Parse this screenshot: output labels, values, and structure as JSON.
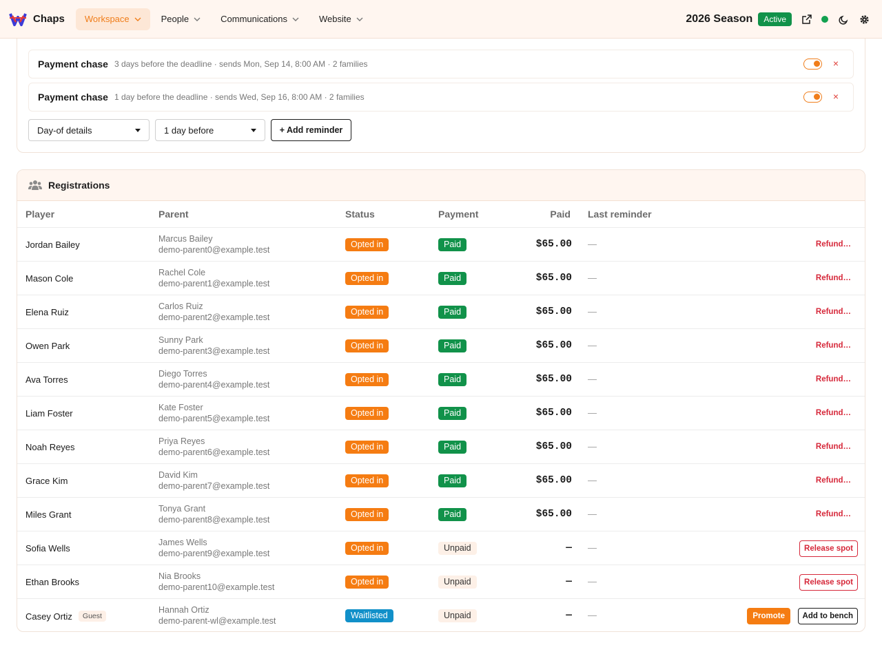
{
  "app": {
    "brand": "Chaps",
    "nav": [
      {
        "label": "Workspace",
        "active": true
      },
      {
        "label": "People",
        "active": false
      },
      {
        "label": "Communications",
        "active": false
      },
      {
        "label": "Website",
        "active": false
      }
    ],
    "season": "2026 Season",
    "season_status": "Active",
    "icons": [
      "external-link-icon",
      "status-dot-icon",
      "moon-icon",
      "gear-icon"
    ],
    "accent_color": "#f07d1a"
  },
  "reminders": {
    "rows": [
      {
        "title": "Payment chase",
        "desc": "3 days before the deadline · sends Mon, Sep 14, 8:00 AM · 2 families",
        "enabled": true
      },
      {
        "title": "Payment chase",
        "desc": "1 day before the deadline · sends Wed, Sep 16, 8:00 AM · 2 families",
        "enabled": true
      }
    ],
    "type_select": "Day-of details",
    "timing_select": "1 day before",
    "add_label": "+ Add reminder",
    "remove_icon": "×"
  },
  "registrations": {
    "title": "Registrations",
    "columns": {
      "player": "Player",
      "parent": "Parent",
      "status": "Status",
      "payment": "Payment",
      "paid": "Paid",
      "last_reminder": "Last reminder"
    },
    "rows": [
      {
        "player": "Jordan Bailey",
        "parent": "Marcus Bailey",
        "email": "demo-parent0@example.test",
        "status": "Opted in",
        "payment": "Paid",
        "paid": "$65.00",
        "last": "—",
        "action": "Refund…"
      },
      {
        "player": "Mason Cole",
        "parent": "Rachel Cole",
        "email": "demo-parent1@example.test",
        "status": "Opted in",
        "payment": "Paid",
        "paid": "$65.00",
        "last": "—",
        "action": "Refund…"
      },
      {
        "player": "Elena Ruiz",
        "parent": "Carlos Ruiz",
        "email": "demo-parent2@example.test",
        "status": "Opted in",
        "payment": "Paid",
        "paid": "$65.00",
        "last": "—",
        "action": "Refund…"
      },
      {
        "player": "Owen Park",
        "parent": "Sunny Park",
        "email": "demo-parent3@example.test",
        "status": "Opted in",
        "payment": "Paid",
        "paid": "$65.00",
        "last": "—",
        "action": "Refund…"
      },
      {
        "player": "Ava Torres",
        "parent": "Diego Torres",
        "email": "demo-parent4@example.test",
        "status": "Opted in",
        "payment": "Paid",
        "paid": "$65.00",
        "last": "—",
        "action": "Refund…"
      },
      {
        "player": "Liam Foster",
        "parent": "Kate Foster",
        "email": "demo-parent5@example.test",
        "status": "Opted in",
        "payment": "Paid",
        "paid": "$65.00",
        "last": "—",
        "action": "Refund…"
      },
      {
        "player": "Noah Reyes",
        "parent": "Priya Reyes",
        "email": "demo-parent6@example.test",
        "status": "Opted in",
        "payment": "Paid",
        "paid": "$65.00",
        "last": "—",
        "action": "Refund…"
      },
      {
        "player": "Grace Kim",
        "parent": "David Kim",
        "email": "demo-parent7@example.test",
        "status": "Opted in",
        "payment": "Paid",
        "paid": "$65.00",
        "last": "—",
        "action": "Refund…"
      },
      {
        "player": "Miles Grant",
        "parent": "Tonya Grant",
        "email": "demo-parent8@example.test",
        "status": "Opted in",
        "payment": "Paid",
        "paid": "$65.00",
        "last": "—",
        "action": "Refund…"
      },
      {
        "player": "Sofia Wells",
        "parent": "James Wells",
        "email": "demo-parent9@example.test",
        "status": "Opted in",
        "payment": "Unpaid",
        "paid": "—",
        "last": "—",
        "action": "Release spot"
      },
      {
        "player": "Ethan Brooks",
        "parent": "Nia Brooks",
        "email": "demo-parent10@example.test",
        "status": "Opted in",
        "payment": "Unpaid",
        "paid": "—",
        "last": "—",
        "action": "Release spot"
      },
      {
        "player": "Casey Ortiz",
        "guest": "Guest",
        "parent": "Hannah Ortiz",
        "email": "demo-parent-wl@example.test",
        "status": "Waitlisted",
        "payment": "Unpaid",
        "paid": "—",
        "last": "—",
        "action": "Promote",
        "action2": "Add to bench"
      }
    ]
  }
}
